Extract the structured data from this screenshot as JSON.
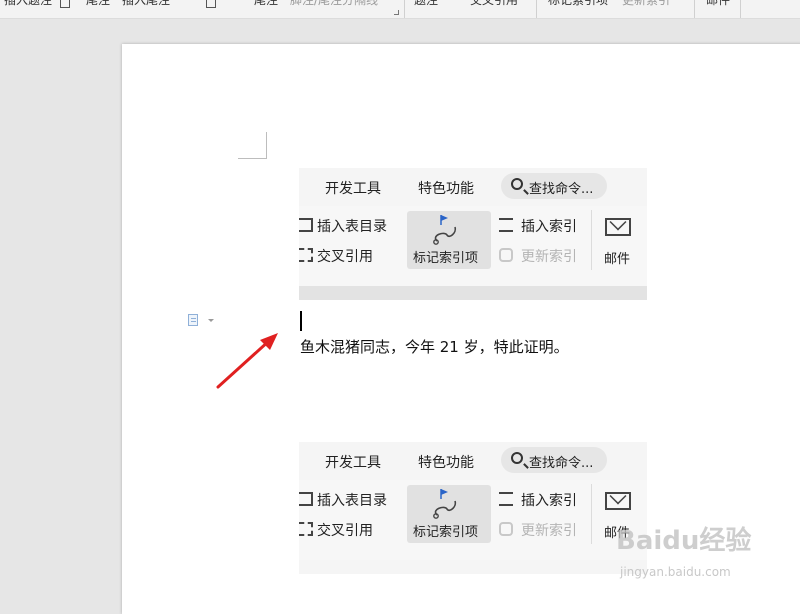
{
  "top_ribbon": {
    "items": [
      "插入题注",
      "尾注",
      "插入尾注",
      "尾注",
      "脚注/尾注分隔线",
      "题注",
      "交叉引用",
      "标记索引项",
      "更新索引",
      "邮件"
    ]
  },
  "document": {
    "body_text": "鱼木混猪同志，今年 21 岁，特此证明。"
  },
  "ribbon": {
    "tabs": [
      "开发工具",
      "特色功能"
    ],
    "search_label": "查找命令...",
    "insert_toc_table": "插入表目录",
    "cross_reference": "交叉引用",
    "mark_index_entry": "标记索引项",
    "insert_index": "插入索引",
    "update_index": "更新索引",
    "mail": "邮件"
  },
  "watermark": {
    "brand": "Baidu经验",
    "url": "jingyan.baidu.com"
  },
  "colors": {
    "arrow": "#e02020",
    "flag": "#2a64c8"
  }
}
